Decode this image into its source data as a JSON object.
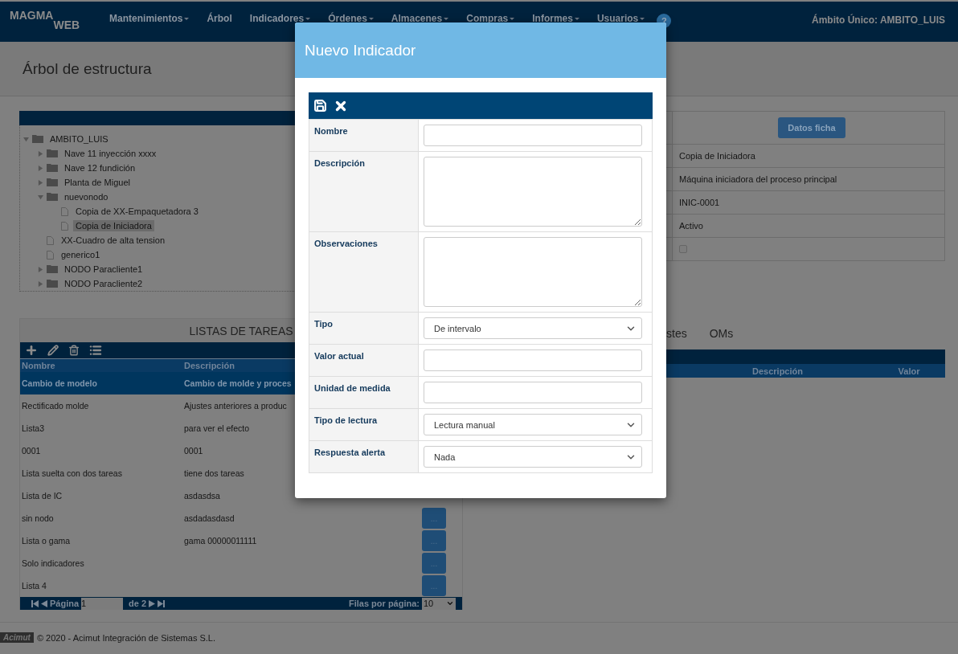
{
  "navbar": {
    "logo": {
      "main": "MAGMA",
      "sub": "WEB"
    },
    "menu": [
      {
        "label": "Mantenimientos",
        "dropdown": true
      },
      {
        "label": "Árbol",
        "dropdown": false
      },
      {
        "label": "Indicadores",
        "dropdown": true
      },
      {
        "label": "Órdenes",
        "dropdown": true
      },
      {
        "label": "Almacenes",
        "dropdown": true
      },
      {
        "label": "Compras",
        "dropdown": true
      },
      {
        "label": "Informes",
        "dropdown": true
      },
      {
        "label": "Usuarios",
        "dropdown": true
      }
    ],
    "help": "?",
    "scope": "Ámbito Único: AMBITO_LUIS"
  },
  "page_title": "Árbol de estructura",
  "tree": [
    {
      "label": "AMBITO_LUIS",
      "kind": "folder",
      "expanded": true,
      "selected": false,
      "children": [
        {
          "label": "Nave 11 inyección xxxx",
          "kind": "folder",
          "expanded": false,
          "selected": false
        },
        {
          "label": "Nave 12 fundición",
          "kind": "folder",
          "expanded": false,
          "selected": false
        },
        {
          "label": "Planta de Miguel",
          "kind": "folder",
          "expanded": false,
          "selected": false
        },
        {
          "label": "nuevonodo",
          "kind": "folder",
          "expanded": true,
          "selected": false,
          "children": [
            {
              "label": "Copia de XX-Empaquetadora 3",
              "kind": "file",
              "selected": false
            },
            {
              "label": "Copia de Iniciadora",
              "kind": "file",
              "selected": true
            }
          ]
        },
        {
          "label": "XX-Cuadro de alta tension",
          "kind": "file",
          "selected": false
        },
        {
          "label": "generico1",
          "kind": "file",
          "selected": false
        },
        {
          "label": "NODO Paracliente1",
          "kind": "folder",
          "expanded": false,
          "selected": false
        },
        {
          "label": "NODO Paracliente2",
          "kind": "folder",
          "expanded": false,
          "selected": false
        }
      ]
    }
  ],
  "details": {
    "button": "Datos ficha",
    "rows": [
      {
        "kind": "text",
        "value": "Copia de Iniciadora"
      },
      {
        "kind": "text",
        "value": "Máquina iniciadora del proceso principal"
      },
      {
        "kind": "text",
        "value": "INIC-0001"
      },
      {
        "kind": "text",
        "value": "Activo"
      },
      {
        "kind": "checkbox",
        "checked": false
      }
    ]
  },
  "tabs": [
    {
      "label": "stes",
      "selected": false
    },
    {
      "label": "OMs",
      "selected": false
    }
  ],
  "side_table": {
    "columns": [
      "Descripción",
      "Valor"
    ]
  },
  "task_lists": {
    "title": "LISTAS DE TAREAS",
    "columns": [
      "Nombre",
      "Descripción"
    ],
    "rows": [
      {
        "name": "Cambio de modelo",
        "description": "Cambio de molde y proces",
        "selected": true
      },
      {
        "name": "Rectificado molde",
        "description": "Ajustes anteriores a produc",
        "selected": false
      },
      {
        "name": "Lista3",
        "description": "para ver el efecto",
        "selected": false
      },
      {
        "name": "0001",
        "description": "0001",
        "selected": false
      },
      {
        "name": "Lista suelta con dos tareas",
        "description": "tiene dos tareas",
        "selected": false
      },
      {
        "name": "Lista de IC",
        "description": "asdasdsa",
        "selected": false
      },
      {
        "name": "sin nodo",
        "description": "asdadasdasd",
        "selected": false,
        "action": "..."
      },
      {
        "name": "Lista o gama",
        "description": "gama 00000011111",
        "selected": false,
        "action": "..."
      },
      {
        "name": "Solo indicadores",
        "description": "",
        "selected": false,
        "action": "..."
      },
      {
        "name": "Lista 4",
        "description": "",
        "selected": false,
        "action": "..."
      }
    ],
    "pager": {
      "page_label": "Página",
      "page": "1",
      "of": "de 2",
      "rows_label": "Filas por página:",
      "rows": "10"
    }
  },
  "footer": {
    "logo": "Acimut",
    "text": "© 2020 - Acimut Integración de Sistemas S.L."
  },
  "modal": {
    "title": "Nuevo Indicador",
    "fields": [
      {
        "label": "Nombre",
        "kind": "input"
      },
      {
        "label": "Descripción",
        "kind": "textarea"
      },
      {
        "label": "Observaciones",
        "kind": "textarea"
      },
      {
        "label": "Tipo",
        "kind": "select",
        "value": "De intervalo"
      },
      {
        "label": "Valor actual",
        "kind": "input"
      },
      {
        "label": "Unidad de medida",
        "kind": "input"
      },
      {
        "label": "Tipo de lectura",
        "kind": "select",
        "value": "Lectura manual"
      },
      {
        "label": "Respuesta alerta",
        "kind": "select",
        "value": "Nada"
      }
    ]
  }
}
